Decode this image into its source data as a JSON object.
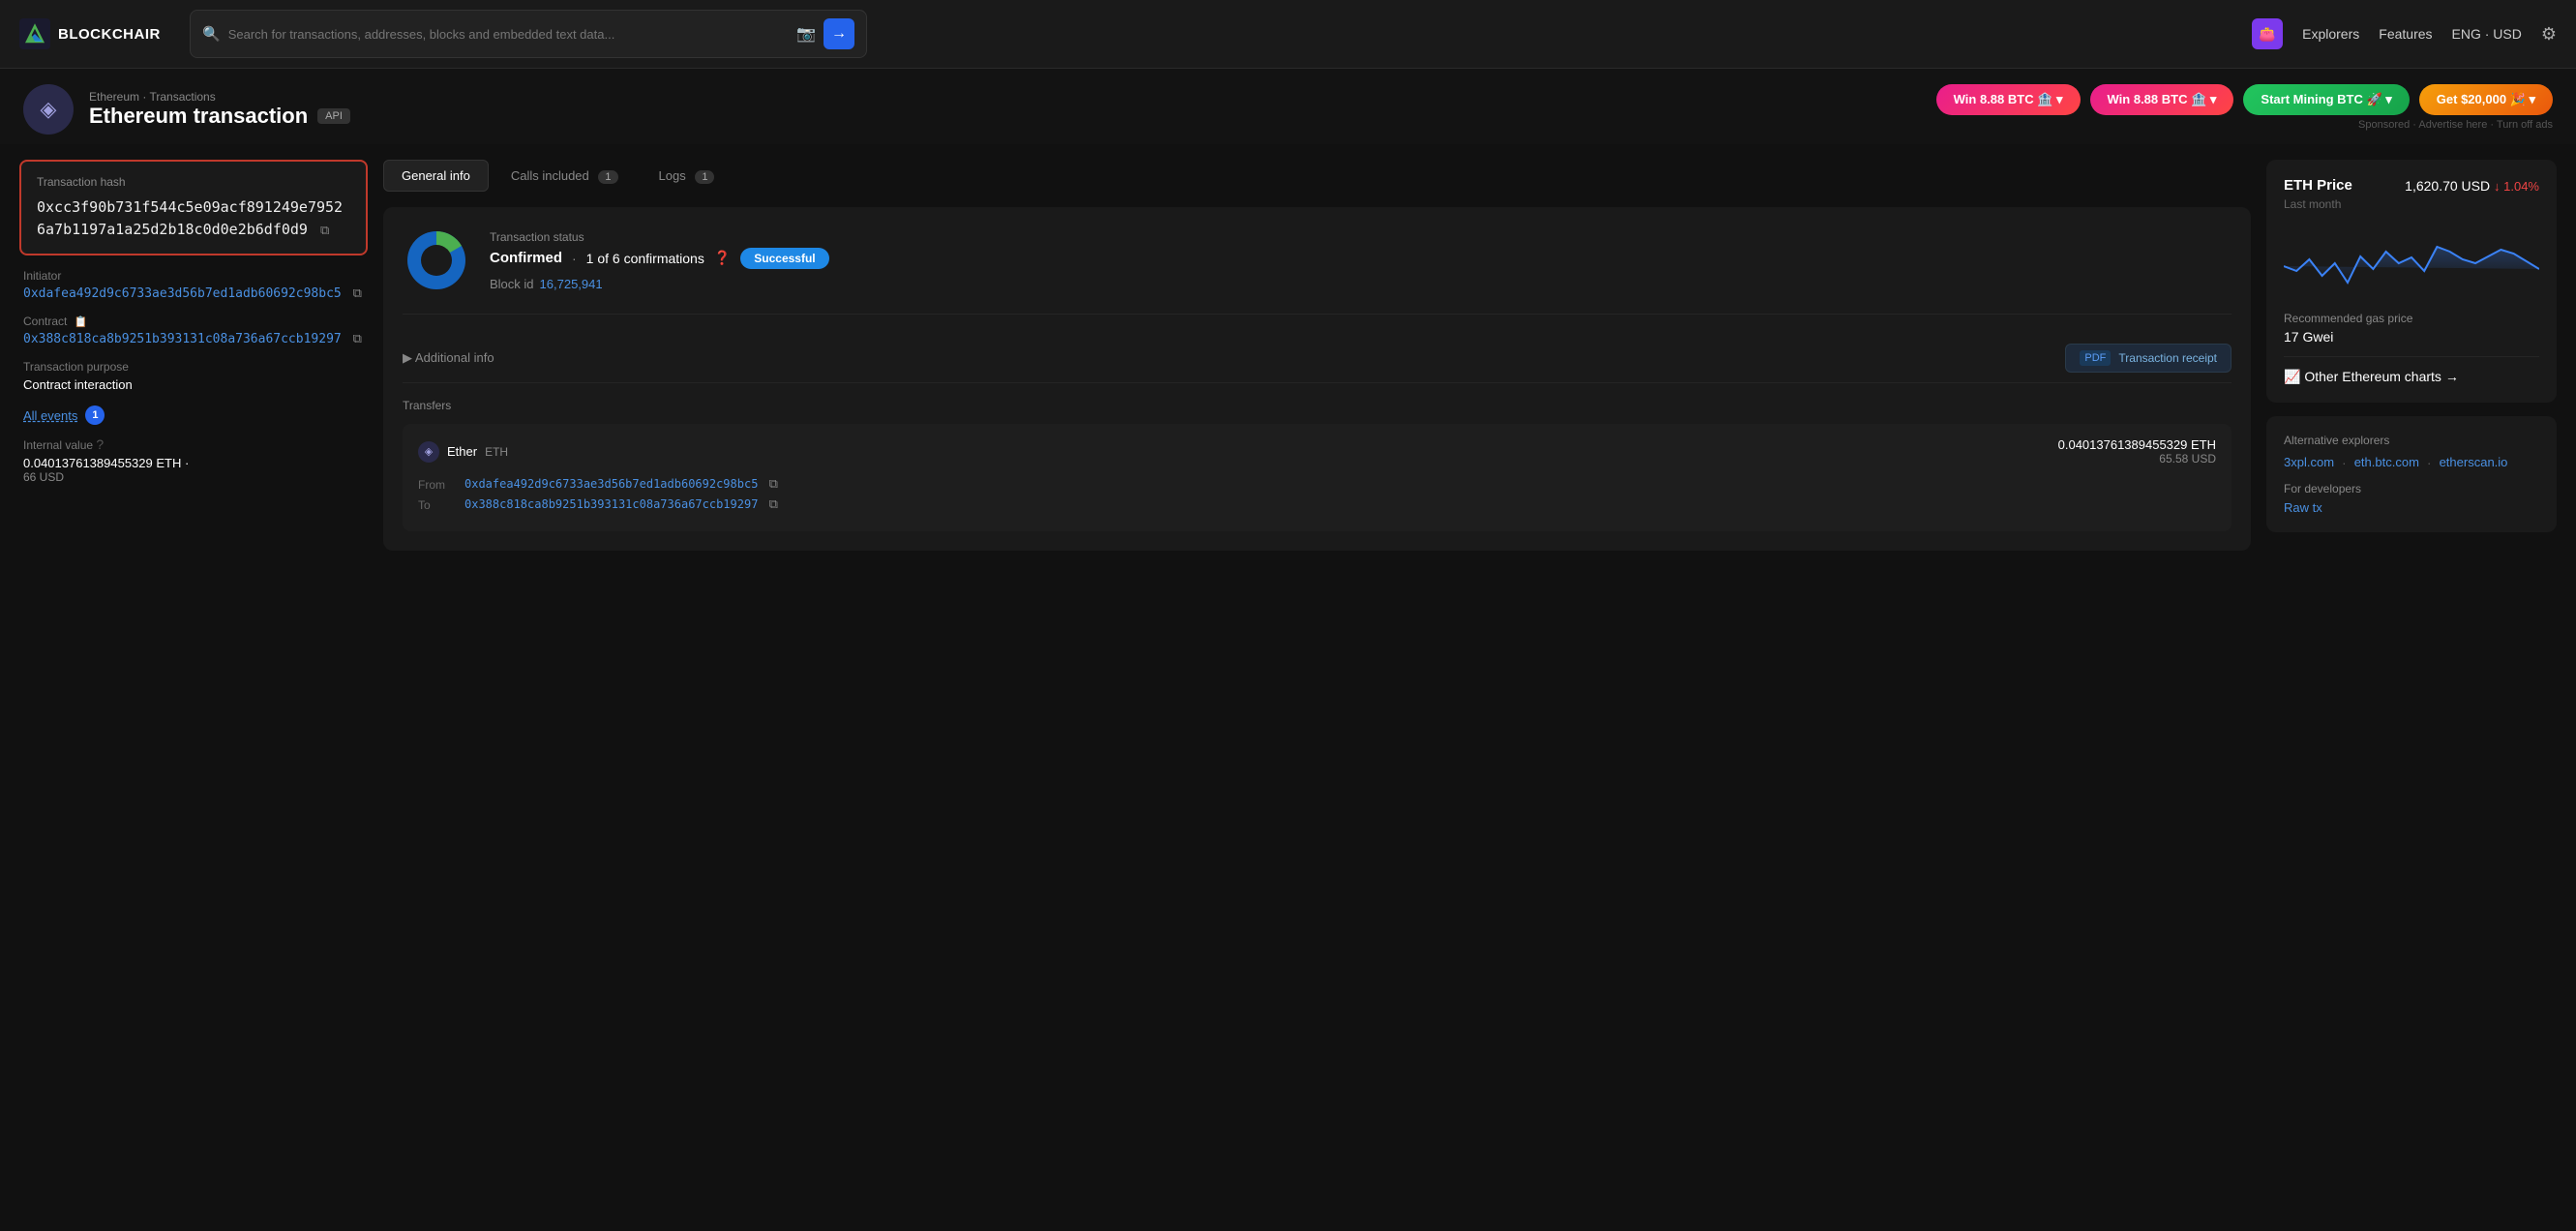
{
  "header": {
    "logo_text": "BLOCKCHAIR",
    "search_placeholder": "Search for transactions, addresses, blocks and embedded text data...",
    "search_btn_arrow": "→",
    "nav_items": [
      "Explorers",
      "Features",
      "ENG · USD"
    ],
    "settings_icon": "⚙"
  },
  "sub_header": {
    "breadcrumb": "Ethereum · Transactions",
    "page_title": "Ethereum transaction",
    "api_badge": "API",
    "promo_buttons": [
      {
        "label": "Win 8.88 BTC 🏦 ▾",
        "style": "pink"
      },
      {
        "label": "Win 8.88 BTC 🏦 ▾",
        "style": "pink2"
      },
      {
        "label": "Start Mining BTC 🚀 ▾",
        "style": "green"
      },
      {
        "label": "Get $20,000 🎉 ▾",
        "style": "orange"
      }
    ],
    "sponsored": "Sponsored · Advertise here · Turn off ads"
  },
  "left_panel": {
    "tx_hash_label": "Transaction hash",
    "tx_hash": "0xcc3f90b731f544c5e09acf891249e79526a7b1197a1a25d2b18c0d0e2b6df0d9",
    "initiator_label": "Initiator",
    "initiator_value": "0xdafea492d9c6733ae3d56b7ed1adb60692c98bc5",
    "contract_label": "Contract",
    "contract_value": "0x388c818ca8b9251b393131c08a736a67ccb19297",
    "tx_purpose_label": "Transaction purpose",
    "tx_purpose_value": "Contract interaction",
    "all_events_label": "All events",
    "all_events_count": "1",
    "internal_value_label": "Internal value",
    "internal_value": "0.04013761389455329 ETH ·",
    "internal_value_usd": "66 USD"
  },
  "center_panel": {
    "tabs": [
      {
        "label": "General info",
        "count": null,
        "active": true
      },
      {
        "label": "Calls included",
        "count": "1",
        "active": false
      },
      {
        "label": "Logs",
        "count": "1",
        "active": false
      }
    ],
    "status_label": "Transaction status",
    "confirmed_text": "Confirmed",
    "confirmations": "1 of 6 confirmations",
    "status_badge": "Successful",
    "block_id_label": "Block id",
    "block_id_value": "16,725,941",
    "additional_info_label": "▶ Additional info",
    "pdf_receipt_label": "Transaction receipt",
    "transfers_label": "Transfers",
    "transfer": {
      "token_name": "Ether",
      "token_symbol": "ETH",
      "amount": "0.04013761389455329 ETH",
      "amount_usd": "65.58 USD",
      "from_label": "From",
      "from_value": "0xdafea492d9c6733ae3d56b7ed1adb60692c98bc5",
      "to_label": "To",
      "to_value": "0x388c818ca8b9251b393131c08a736a67ccb19297"
    }
  },
  "right_panel": {
    "eth_price_title": "ETH Price",
    "eth_price_value": "1,620.70 USD",
    "price_change": "↓ 1.04%",
    "last_month": "Last month",
    "gas_label": "Recommended gas price",
    "gas_value": "17 Gwei",
    "other_charts_label": "📈 Other Ethereum charts →",
    "alt_explorers_label": "Alternative explorers",
    "alt_links": [
      "3xpl.com",
      "eth.btc.com",
      "etherscan.io"
    ],
    "for_dev_label": "For developers",
    "raw_tx_label": "Raw tx",
    "chart_data": [
      40,
      35,
      42,
      30,
      38,
      25,
      45,
      32,
      50,
      38,
      44,
      30,
      55,
      50,
      42,
      38,
      45,
      52,
      48,
      40
    ]
  }
}
